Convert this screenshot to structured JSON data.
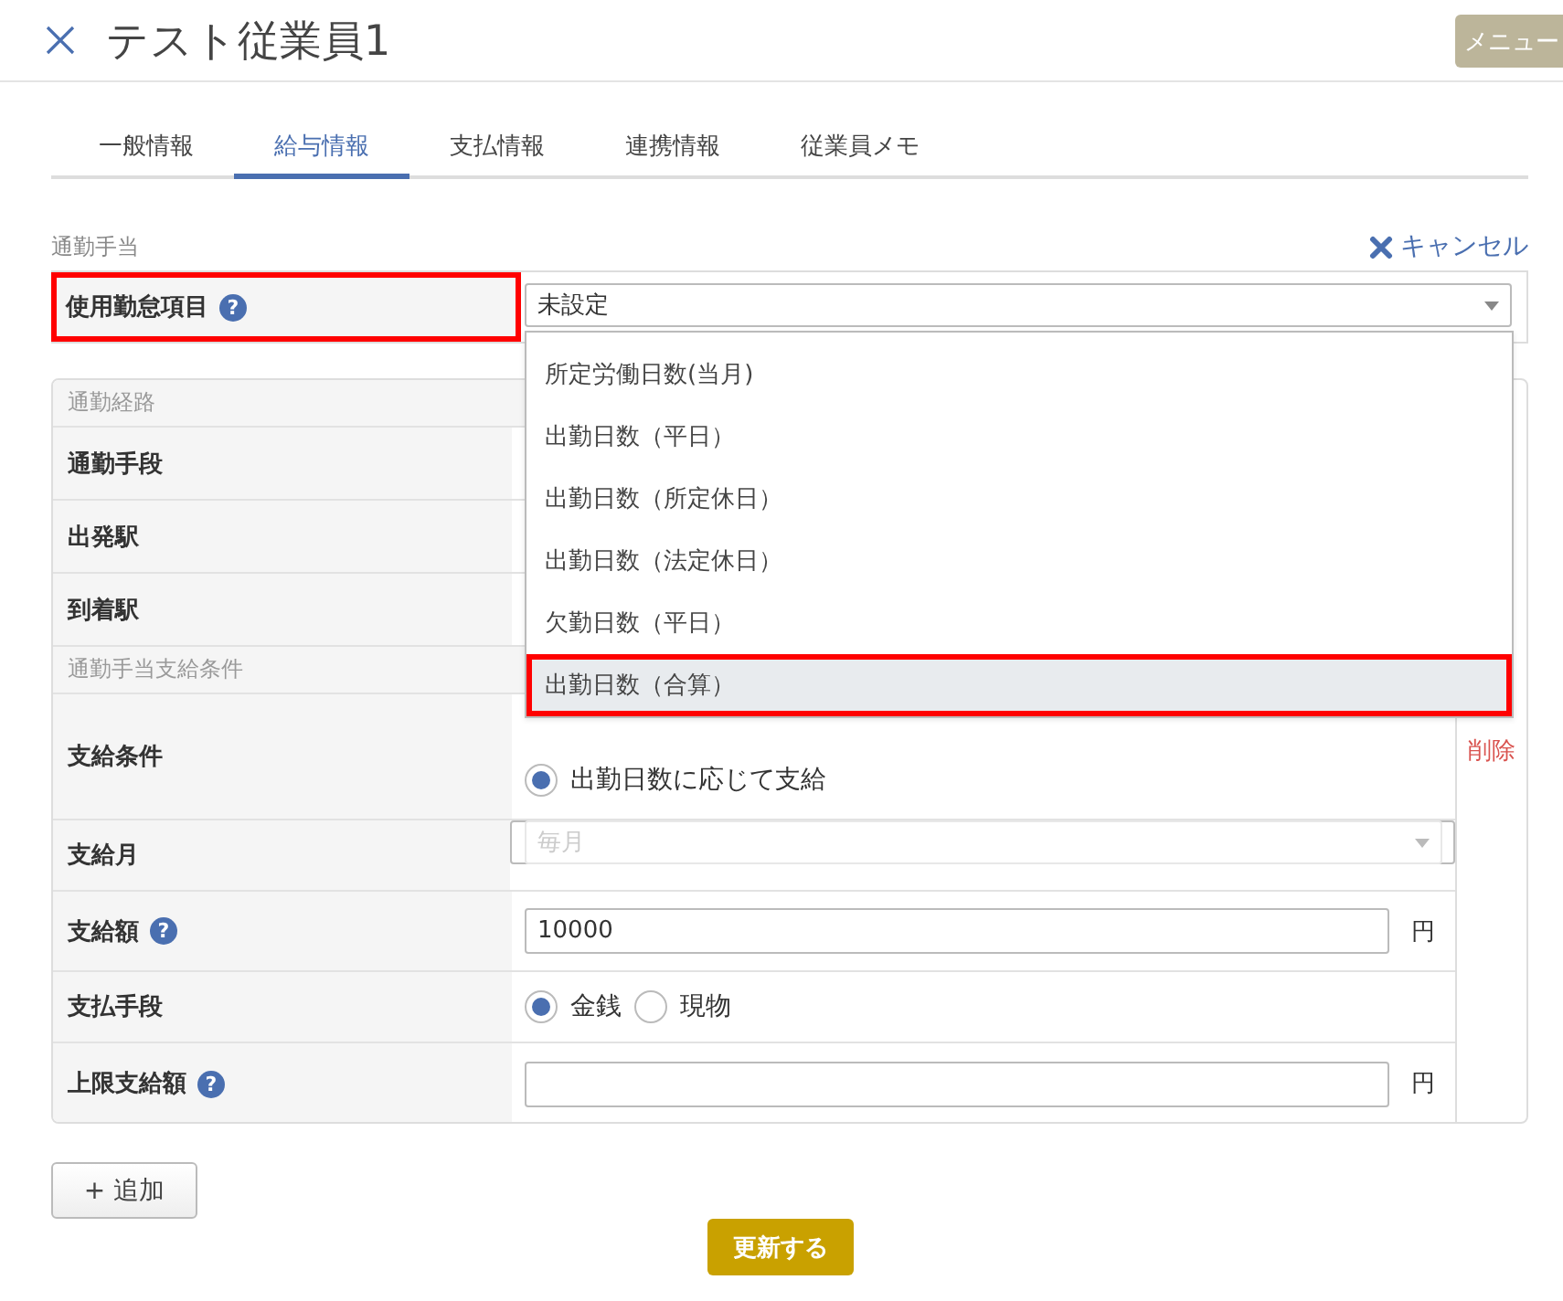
{
  "header": {
    "title": "テスト従業員1",
    "menu_button": "メニュー"
  },
  "tabs": [
    {
      "label": "一般情報",
      "selected": false
    },
    {
      "label": "給与情報",
      "selected": true
    },
    {
      "label": "支払情報",
      "selected": false
    },
    {
      "label": "連携情報",
      "selected": false
    },
    {
      "label": "従業員メモ",
      "selected": false
    }
  ],
  "section": {
    "title": "通勤手当",
    "cancel": "キャンセル"
  },
  "attendance_field": {
    "label": "使用勤怠項目",
    "help_icon": "?",
    "value": "未設定",
    "highlighted": true
  },
  "dropdown": {
    "options": [
      {
        "label": "所定労働日数(当月)",
        "selected": false,
        "highlighted": false
      },
      {
        "label": "出勤日数（平日）",
        "selected": false,
        "highlighted": false
      },
      {
        "label": "出勤日数（所定休日）",
        "selected": false,
        "highlighted": false
      },
      {
        "label": "出勤日数（法定休日）",
        "selected": false,
        "highlighted": false
      },
      {
        "label": "欠勤日数（平日）",
        "selected": false,
        "highlighted": false
      },
      {
        "label": "出勤日数（合算）",
        "selected": true,
        "highlighted": true
      }
    ]
  },
  "route": {
    "title": "通勤経路",
    "rows": [
      {
        "label": "通勤手段"
      },
      {
        "label": "出発駅"
      },
      {
        "label": "到着駅"
      }
    ]
  },
  "conditions": {
    "title": "通勤手当支給条件",
    "rows": [
      {
        "kind": "radio-stack",
        "label": "支給条件",
        "options": [
          {
            "label": "出勤日数に応じて支給",
            "selected": true
          }
        ]
      },
      {
        "kind": "select",
        "label": "支給月",
        "value": "毎月",
        "disabled": true
      },
      {
        "kind": "input",
        "label": "支給額",
        "help_icon": "?",
        "value": "10000",
        "unit": "円"
      },
      {
        "kind": "radio",
        "label": "支払手段",
        "options": [
          {
            "label": "金銭",
            "selected": true
          },
          {
            "label": "現物",
            "selected": false
          }
        ]
      },
      {
        "kind": "input",
        "label": "上限支給額",
        "help_icon": "?",
        "unit": "円"
      }
    ]
  },
  "delete_link": "削除",
  "add_button": "+ 追加",
  "submit_button": "更新する"
}
